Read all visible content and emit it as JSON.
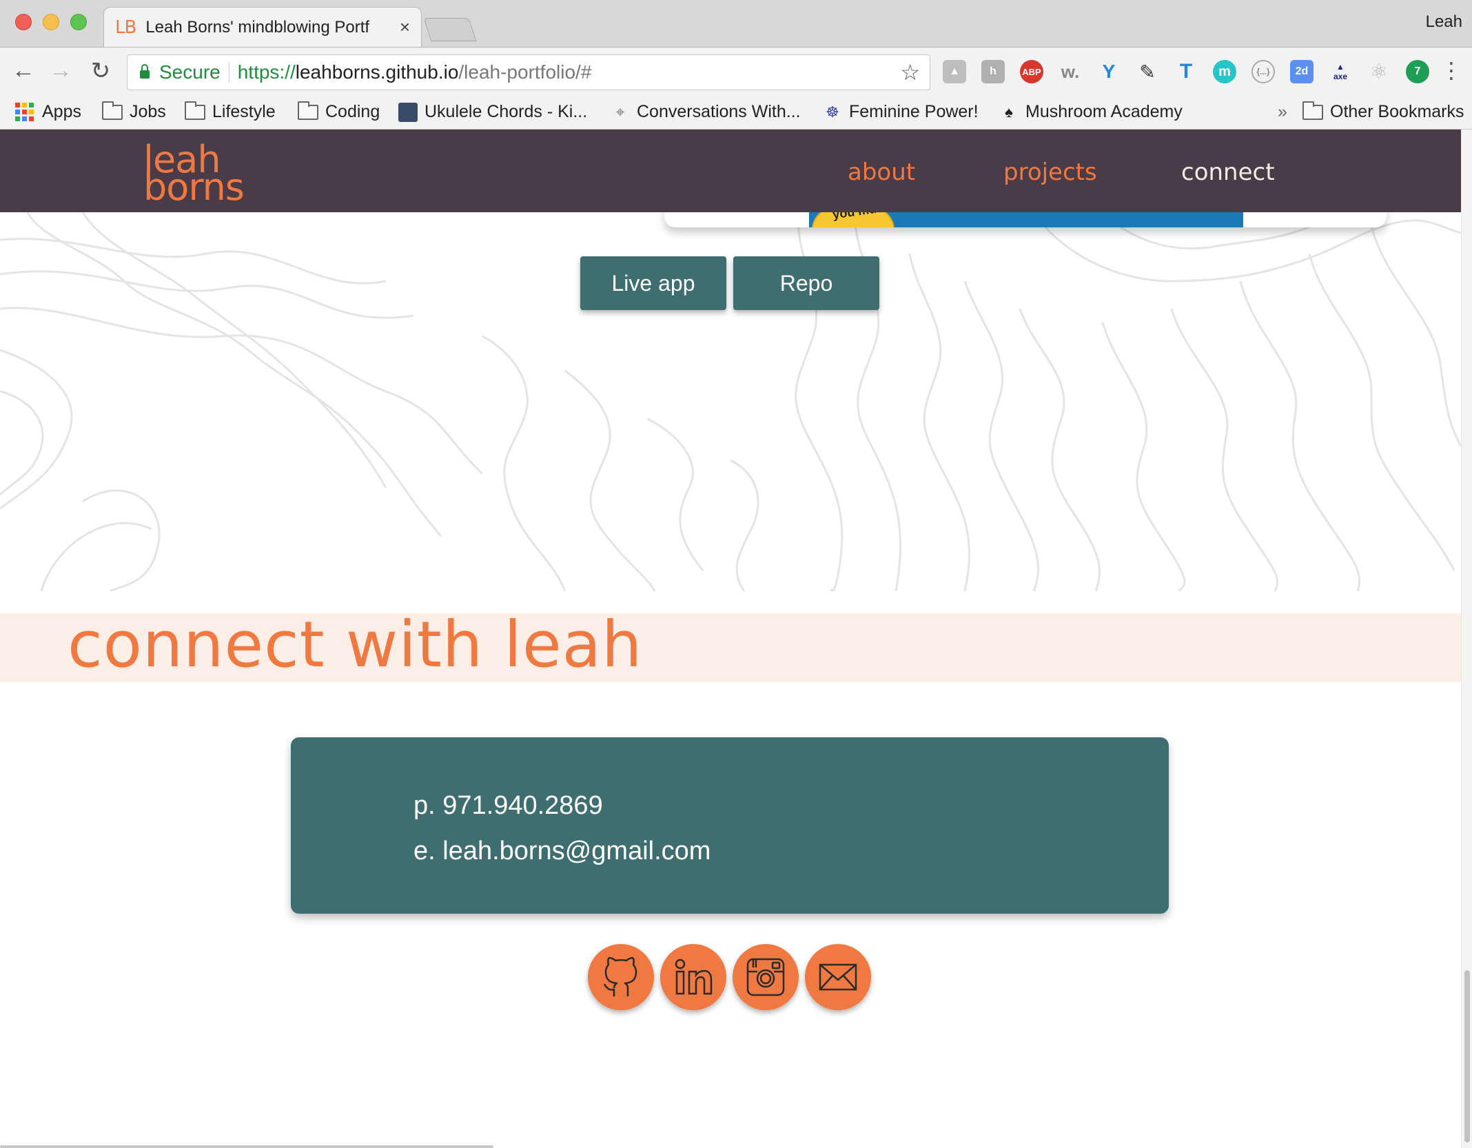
{
  "browser": {
    "tab_title": "Leah Borns' mindblowing Portf",
    "tab_favicon": "LB",
    "tab_close": "×",
    "profile_name": "Leah",
    "secure_label": "Secure",
    "url_scheme": "https://",
    "url_host": "leahborns.github.io",
    "url_path": "/leah-portfolio/#",
    "bookmarks": [
      "Apps",
      "Jobs",
      "Lifestyle",
      "Coding",
      "Ukulele Chords - Ki...",
      "Conversations With...",
      "Feminine Power!",
      "Mushroom Academy"
    ],
    "bookmarks_overflow": "»",
    "other_bookmarks": "Other Bookmarks",
    "extensions": [
      "drive-icon",
      "helper-icon",
      "adblock-icon",
      "w-icon",
      "vimeo-icon",
      "eyedropper-icon",
      "text-icon",
      "m-icon",
      "json-icon",
      "calendar-icon",
      "axe-icon",
      "react-icon",
      "hangouts-icon"
    ],
    "extension_labels": {
      "adblock": "ABP",
      "w": "w.",
      "m": "m",
      "json": "{...}",
      "calendar": "2d",
      "axe": "axe",
      "hangouts": "7"
    }
  },
  "site": {
    "logo_line1": "leah",
    "logo_line2": "borns",
    "nav": {
      "about": "about",
      "projects": "projects",
      "connect": "connect"
    },
    "project": {
      "badge_text": "you mute",
      "live_label": "Live app",
      "repo_label": "Repo"
    },
    "connect_title": "connect with leah",
    "contact": {
      "phone": "p. 971.940.2869",
      "email": "e. leah.borns@gmail.com"
    },
    "social": [
      "github-icon",
      "linkedin-icon",
      "instagram-icon",
      "mail-icon"
    ]
  },
  "colors": {
    "accent": "#f07841",
    "header_bg": "#493b47",
    "teal": "#3f6e70",
    "band": "#fbeee6"
  }
}
